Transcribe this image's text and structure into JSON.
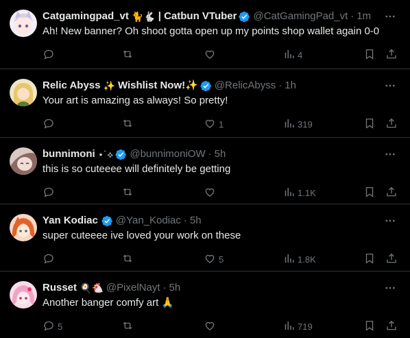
{
  "replies": [
    {
      "name": "Catgamingpad_vt",
      "name_emoji": "🐈🐇",
      "name_suffix": "| Catbun VTuber",
      "verified": true,
      "handle": "@CatGamingPad_vt",
      "time": "1m",
      "text": "Ah! New banner? Oh shoot gotta open up my points shop wallet again 0-0",
      "counts": {
        "reply": "",
        "retweet": "",
        "like": "",
        "views": "4"
      }
    },
    {
      "name": "Relic Abyss",
      "name_emoji": "✨",
      "name_suffix": "Wishlist Now!✨",
      "verified": true,
      "handle": "@RelicAbyss",
      "time": "1h",
      "text": "Your art is amazing as always! So pretty!",
      "counts": {
        "reply": "",
        "retweet": "",
        "like": "1",
        "views": "319"
      }
    },
    {
      "name": "bunnimoni",
      "name_emoji": "⋆˙⟡",
      "name_suffix": "",
      "verified": true,
      "handle": "@bunnimoniOW",
      "time": "5h",
      "text": "this is so cuteeee will definitely be getting",
      "counts": {
        "reply": "",
        "retweet": "",
        "like": "",
        "views": "1.1K"
      }
    },
    {
      "name": "Yan Kodiac",
      "name_emoji": "",
      "name_suffix": "",
      "verified": true,
      "handle": "@Yan_Kodiac",
      "time": "5h",
      "text": "super cuteeee ive loved your work on these",
      "counts": {
        "reply": "",
        "retweet": "",
        "like": "5",
        "views": "1.8K"
      }
    },
    {
      "name": "Russet",
      "name_emoji": "🍳🐔",
      "name_suffix": "",
      "verified": false,
      "handle": "@PixelNayt",
      "time": "5h",
      "text": "Another banger comfy art 🙏",
      "counts": {
        "reply": "5",
        "retweet": "",
        "like": "",
        "views": "719"
      }
    }
  ],
  "colors": {
    "background": "#000000",
    "text": "#e7e9ea",
    "muted": "#71767b",
    "divider": "#2f3336",
    "verified": "#1d9bf0"
  },
  "icons": [
    "reply-icon",
    "retweet-icon",
    "like-icon",
    "views-icon",
    "bookmark-icon",
    "share-icon",
    "more-icon",
    "verified-badge-icon"
  ]
}
